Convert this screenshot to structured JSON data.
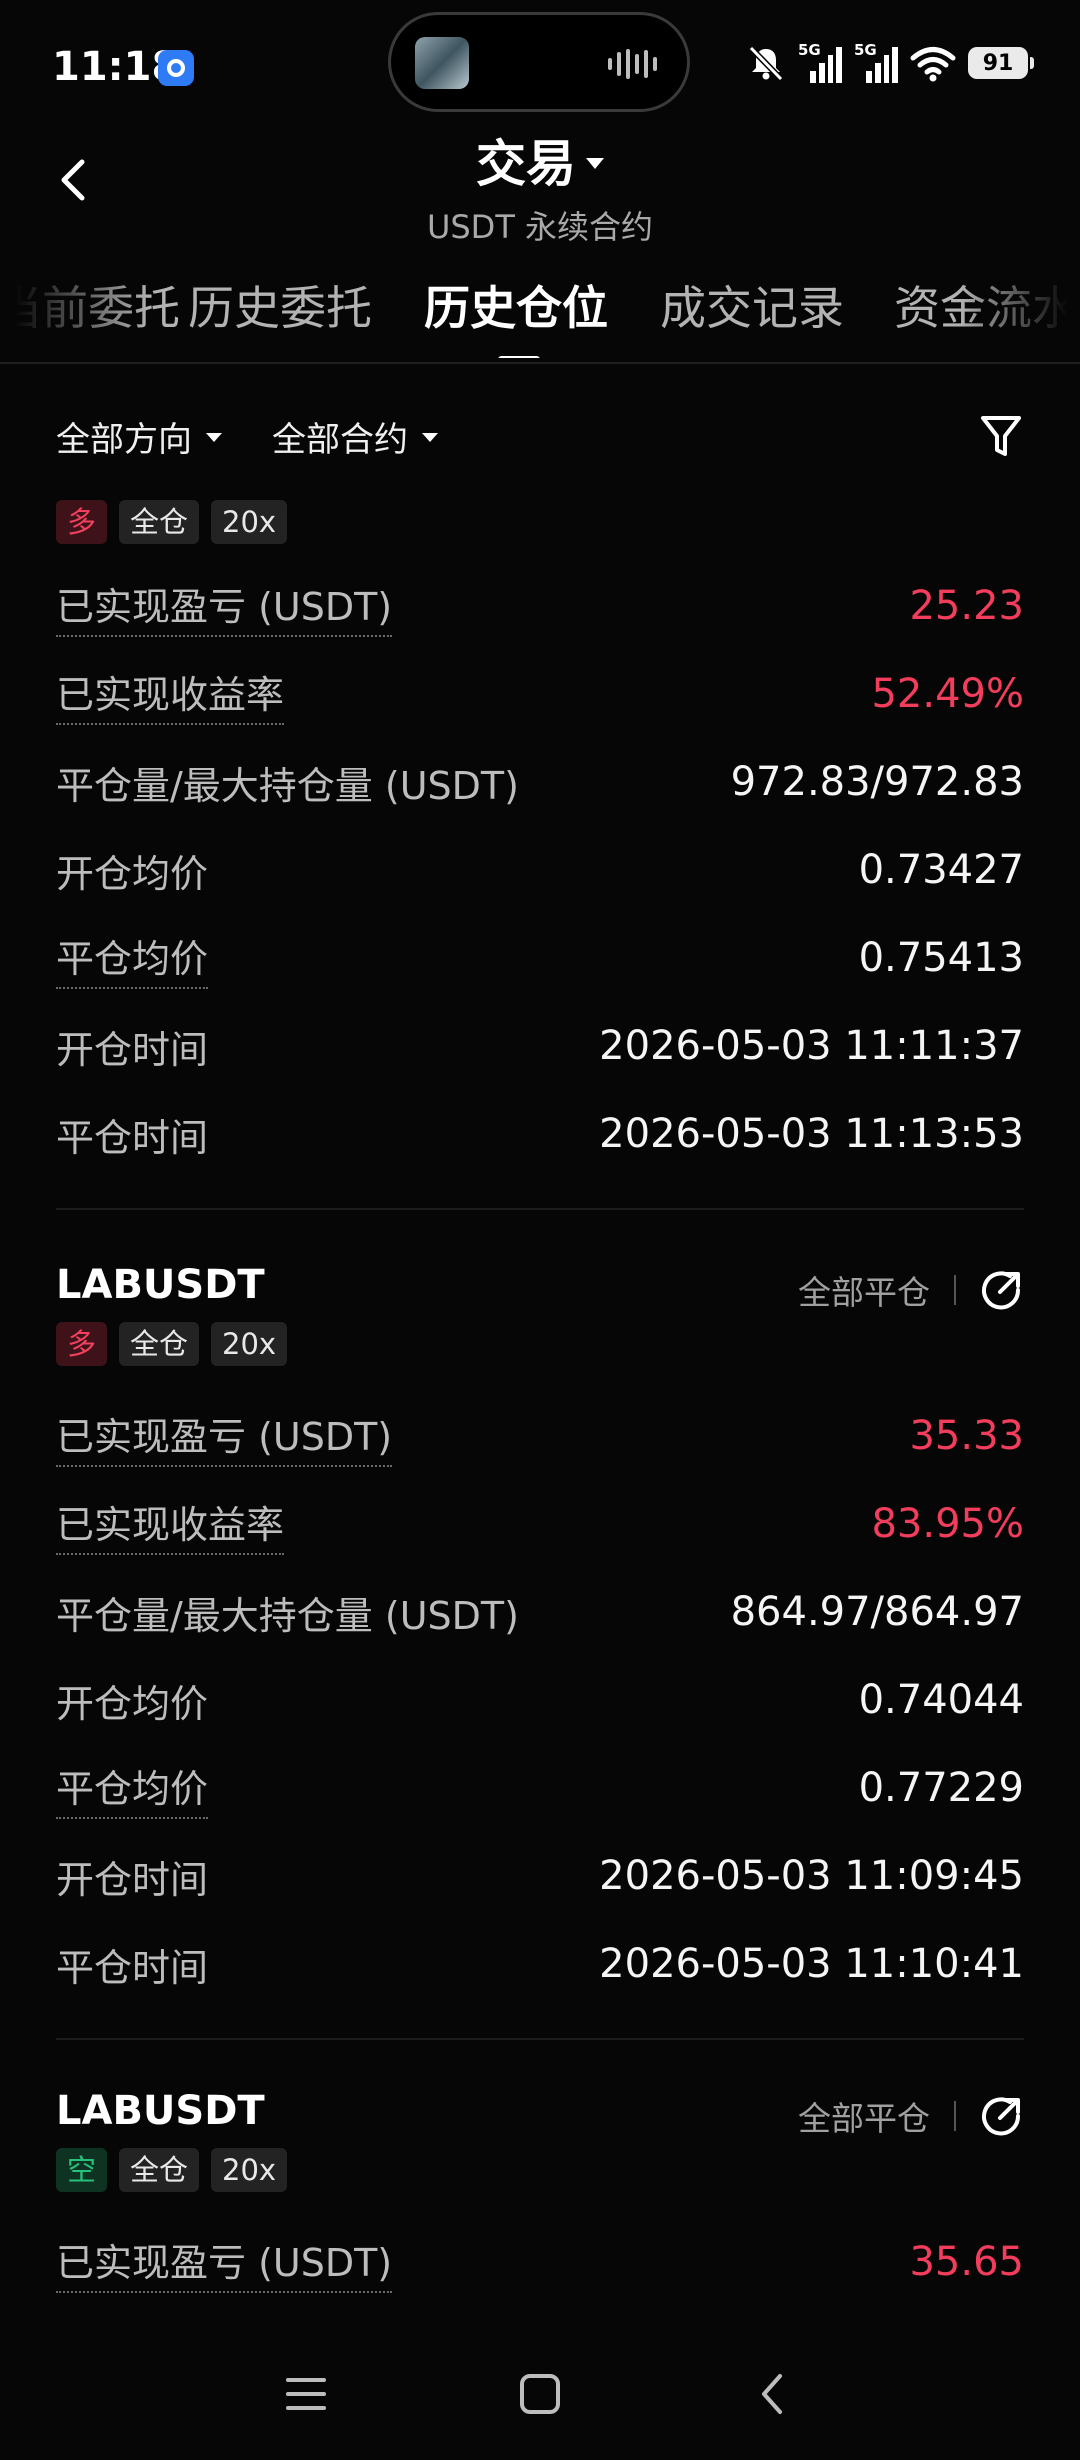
{
  "status_bar": {
    "time": "11:18",
    "battery": "91",
    "network_1": "5G",
    "network_2": "5G",
    "icons": [
      "app-notification-icon",
      "bell-muted-icon",
      "signal-icon",
      "signal-icon",
      "wifi-icon",
      "battery-icon"
    ]
  },
  "header": {
    "title": "交易",
    "subtitle": "USDT 永续合约"
  },
  "tabs": [
    {
      "label": "当前委托"
    },
    {
      "label": "历史委托"
    },
    {
      "label": "历史仓位"
    },
    {
      "label": "成交记录"
    },
    {
      "label": "资金流水"
    }
  ],
  "filters": {
    "direction": "全部方向",
    "contract": "全部合约"
  },
  "labels": {
    "realized_pnl": "已实现盈亏 (USDT)",
    "realized_roi": "已实现收益率",
    "close_max_qty": "平仓量/最大持仓量 (USDT)",
    "open_avg": "开仓均价",
    "close_avg": "平仓均价",
    "open_time": "开仓时间",
    "close_time": "平仓时间",
    "close_all": "全部平仓",
    "margin_mode": "全仓",
    "leverage": "20x"
  },
  "positions": [
    {
      "symbol": "",
      "side": "多",
      "realized_pnl": "25.23",
      "realized_roi": "52.49%",
      "close_max_qty": "972.83/972.83",
      "open_avg": "0.73427",
      "close_avg": "0.75413",
      "open_time": "2026-05-03 11:11:37",
      "close_time": "2026-05-03 11:13:53"
    },
    {
      "symbol": "LABUSDT",
      "side": "多",
      "realized_pnl": "35.33",
      "realized_roi": "83.95%",
      "close_max_qty": "864.97/864.97",
      "open_avg": "0.74044",
      "close_avg": "0.77229",
      "open_time": "2026-05-03 11:09:45",
      "close_time": "2026-05-03 11:10:41"
    },
    {
      "symbol": "LABUSDT",
      "side": "空",
      "realized_pnl": "35.65"
    }
  ],
  "colors": {
    "profit_red": "#f23d5c",
    "long_red": "#f2405e",
    "short_green": "#24c27a",
    "background": "#060606"
  }
}
